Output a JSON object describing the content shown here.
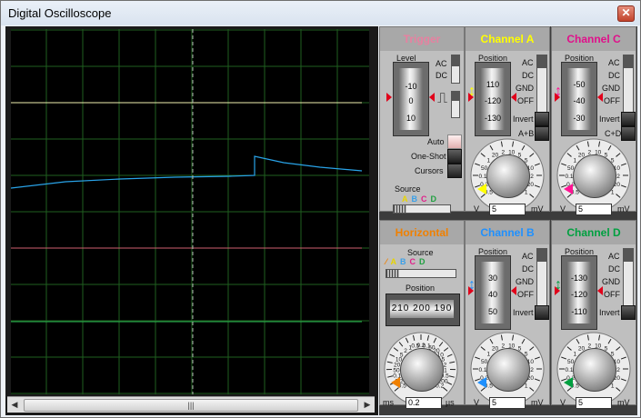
{
  "window": {
    "title": "Digital Oscilloscope",
    "close_glyph": "✕"
  },
  "scrollbar": {
    "left_arrow": "◀",
    "right_arrow": "▶",
    "thumb_grip": "|||"
  },
  "colors": {
    "channel_a": "#ffff00",
    "channel_b": "#1e90ff",
    "channel_c": "#ff1493",
    "channel_d": "#00a040",
    "trigger": "#e05060",
    "horizontal": "#f08000",
    "grid": "#1f5f1f"
  },
  "trigger": {
    "title": "Trigger",
    "level_label": "Level",
    "coupling": [
      "AC",
      "DC"
    ],
    "level_wheel": [
      "-10",
      "0",
      "10"
    ],
    "edge_glyph": "⎍",
    "modes": [
      "Auto",
      "One-Shot",
      "Cursors"
    ],
    "source_label": "Source",
    "source_letters": [
      "A",
      "B",
      "C",
      "D"
    ]
  },
  "horizontal": {
    "title": "Horizontal",
    "source_label": "Source",
    "source_letters": [
      "A",
      "B",
      "C",
      "D"
    ],
    "position_label": "Position",
    "position_scale": "210 200 190",
    "dial_ticks": [
      "0.5",
      "0.2",
      "0.1",
      "50",
      "20",
      "10",
      "5",
      "2",
      "1",
      "0.5",
      "0.2",
      "0.1",
      "50",
      "20",
      "10",
      "5",
      "2",
      "1",
      "0.5",
      "200",
      "0.2"
    ],
    "value": "0.2",
    "unit_left": "ms",
    "unit_right": "µs"
  },
  "channels": [
    {
      "id": "a",
      "title": "Channel A",
      "wheel": [
        "110",
        "-120",
        "-130"
      ],
      "coupling": [
        "AC",
        "DC",
        "GND",
        "OFF"
      ],
      "options": [
        "Invert",
        "A+B"
      ],
      "value": "5",
      "unit_left": "V",
      "unit_right": "mV"
    },
    {
      "id": "c",
      "title": "Channel C",
      "wheel": [
        "-50",
        "-40",
        "-30"
      ],
      "coupling": [
        "AC",
        "DC",
        "GND",
        "OFF"
      ],
      "options": [
        "Invert",
        "C+D"
      ],
      "value": "5",
      "unit_left": "V",
      "unit_right": "mV"
    },
    {
      "id": "b",
      "title": "Channel B",
      "wheel": [
        "30",
        "40",
        "50"
      ],
      "coupling": [
        "AC",
        "DC",
        "GND",
        "OFF"
      ],
      "options": [
        "Invert"
      ],
      "value": "5",
      "unit_left": "V",
      "unit_right": "mV"
    },
    {
      "id": "d",
      "title": "Channel D",
      "wheel": [
        "-130",
        "-120",
        "-110"
      ],
      "coupling": [
        "AC",
        "DC",
        "GND",
        "OFF"
      ],
      "options": [
        "Invert"
      ],
      "value": "5",
      "unit_left": "V",
      "unit_right": "mV"
    }
  ],
  "volt_dial_ticks": [
    "0.5",
    "0.2",
    "0.1",
    "50",
    "1",
    "20",
    "2",
    "10",
    "5",
    "5",
    "10",
    "2",
    "20",
    "1"
  ]
}
